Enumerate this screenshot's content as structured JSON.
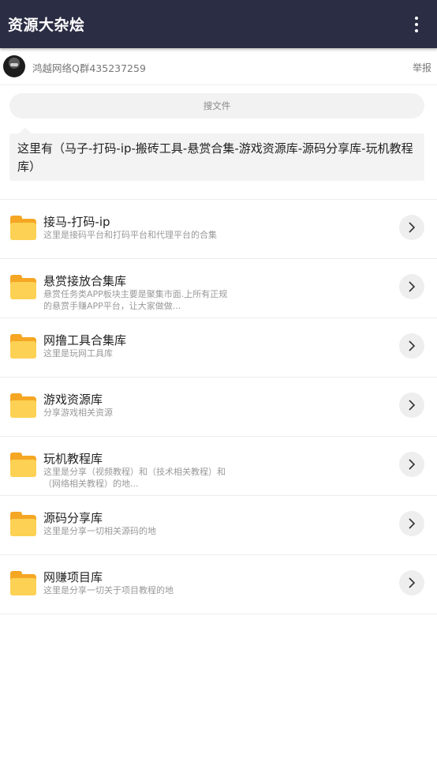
{
  "appbar": {
    "title": "资源大杂烩",
    "menu_icon": "more-vert-icon"
  },
  "owner": {
    "name": "鸿越网络Q群435237259",
    "report_label": "举报"
  },
  "search": {
    "placeholder": "搜文件"
  },
  "description": "这里有（马子-打码-ip-搬砖工具-悬赏合集-游戏资源库-源码分享库-玩机教程库）",
  "folders": [
    {
      "title": "接马-打码-ip",
      "subtitle": "这里是接码平台和打码平台和代理平台的合集"
    },
    {
      "title": "悬赏接放合集库",
      "subtitle": "悬赏任务类APP板块主要是聚集市面.上所有正规的悬赏手赚APP平台，让大家做做..."
    },
    {
      "title": "网撸工具合集库",
      "subtitle": "这里是玩网工具库"
    },
    {
      "title": "游戏资源库",
      "subtitle": "分享游戏相关资源"
    },
    {
      "title": "玩机教程库",
      "subtitle": "这里是分享（视频教程）和（技术相关教程）和（网络相关教程）的地..."
    },
    {
      "title": "源码分享库",
      "subtitle": "这里是分享一切相关源码的地"
    },
    {
      "title": "网赚项目库",
      "subtitle": "这里是分享一切关于项目教程的地"
    }
  ],
  "colors": {
    "appbar": "#2b2d45",
    "folder": "#fdd153",
    "folder_back": "#f5a623"
  }
}
